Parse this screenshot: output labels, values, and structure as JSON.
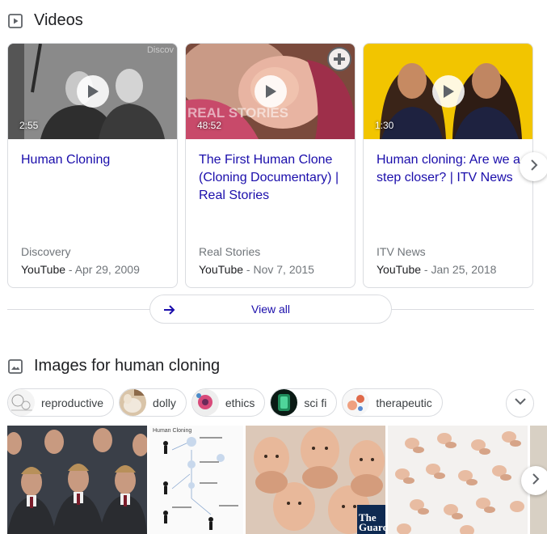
{
  "videos_section": {
    "title": "Videos",
    "icon": "video-play-icon",
    "cards": [
      {
        "duration": "2:55",
        "watermark": "Discov",
        "title": "Human Cloning",
        "source": "Discovery",
        "platform": "YouTube",
        "date": "Apr 29, 2009"
      },
      {
        "duration": "48:52",
        "watermark": "REAL STORIES",
        "title": "The First Human Clone (Cloning Documentary) | Real Stories",
        "source": "Real Stories",
        "platform": "YouTube",
        "date": "Nov 7, 2015"
      },
      {
        "duration": "1:30",
        "title": "Human cloning: Are we a step closer? | ITV News",
        "source": "ITV News",
        "platform": "YouTube",
        "date": "Jan 25, 2018"
      }
    ],
    "separator": " - ",
    "view_all_label": "View all"
  },
  "images_section": {
    "title": "Images for human cloning",
    "icon": "image-icon",
    "chips": [
      {
        "label": "reproductive"
      },
      {
        "label": "dolly"
      },
      {
        "label": "ethics"
      },
      {
        "label": "sci fi"
      },
      {
        "label": "therapeutic"
      }
    ],
    "diagram_title": "Human Cloning",
    "guardian_logo": "The Guardian"
  },
  "colors": {
    "link": "#1a0dab",
    "muted": "#70757a",
    "border": "#dadce0",
    "thumb_yellow": "#f2c500"
  }
}
